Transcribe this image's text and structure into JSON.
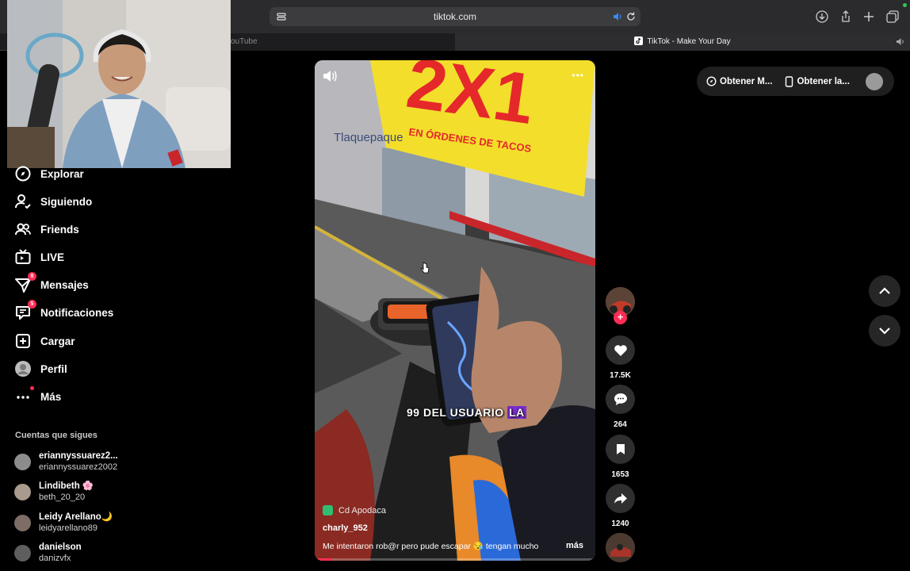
{
  "browser": {
    "url": "tiktok.com",
    "tabs": [
      {
        "label": "ouTube"
      },
      {
        "label": "TikTok - Make Your Day"
      }
    ]
  },
  "sidebar": {
    "items": [
      {
        "label": "Explorar",
        "icon": "compass-icon"
      },
      {
        "label": "Siguiendo",
        "icon": "user-follow-icon"
      },
      {
        "label": "Friends",
        "icon": "friends-icon"
      },
      {
        "label": "LIVE",
        "icon": "live-tv-icon"
      },
      {
        "label": "Mensajes",
        "icon": "messages-icon",
        "badge": "8"
      },
      {
        "label": "Notificaciones",
        "icon": "notifications-icon",
        "badge": "5"
      },
      {
        "label": "Cargar",
        "icon": "upload-icon"
      },
      {
        "label": "Perfil",
        "icon": "profile-avatar"
      },
      {
        "label": "Más",
        "icon": "more-icon"
      }
    ],
    "following_title": "Cuentas que sigues",
    "accounts": [
      {
        "name": "eriannyssuarez2...",
        "handle": "eriannyssuarez2002"
      },
      {
        "name": "Lindibeth 🌸",
        "handle": "beth_20_20"
      },
      {
        "name": "Leidy Arellano🌙",
        "handle": "leidyarellano89"
      },
      {
        "name": "danielson",
        "handle": "danizvfx"
      }
    ]
  },
  "video": {
    "sign_text": "2X1",
    "sign_subtext": "EN ÓRDENES DE TACOS",
    "store_text": "Tlaquepaque",
    "subtitle_main": "99 DEL USUARIO",
    "subtitle_highlight": "LA",
    "location": "Cd Apodaca",
    "username": "charly_952",
    "description": "Me intentaron rob@r pero pude escapar 😪 tengan mucho",
    "more_label": "más",
    "progress": 0.06
  },
  "actions": {
    "likes": "17.5K",
    "comments": "264",
    "saves": "1653",
    "shares": "1240"
  },
  "top_pill": {
    "btn1": "Obtener M...",
    "btn2": "Obtener la..."
  },
  "colors": {
    "accent": "#fe2c55",
    "background": "#000000",
    "sign_yellow": "#f3de2c",
    "sign_red": "#e5282a"
  }
}
